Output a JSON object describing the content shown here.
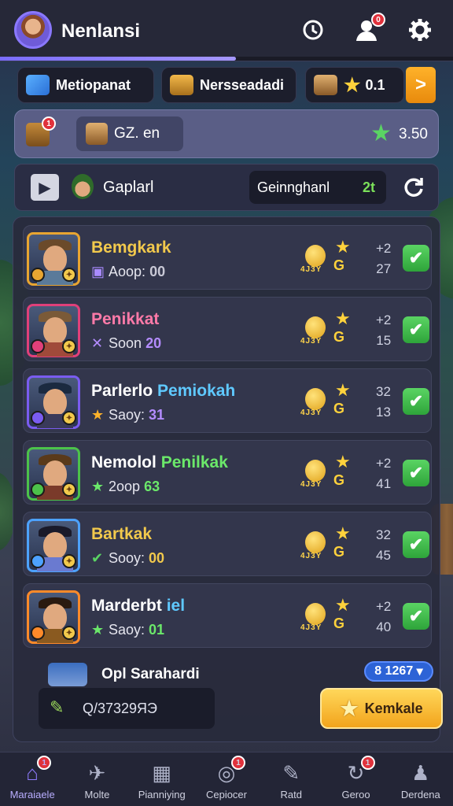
{
  "header": {
    "title": "Nenlansi",
    "notification_badge": "0",
    "icons": [
      "history-icon",
      "profile-icon",
      "settings-icon"
    ],
    "progress_fraction": 0.52
  },
  "resources": {
    "item1_label": "Metiopanat",
    "item2_label": "Nersseadadi",
    "star_value": "0.1",
    "plus_label": ">"
  },
  "info_panel": {
    "chest_badge": "1",
    "pill_value": "GZ. en",
    "star_value": "3.50"
  },
  "gameplay": {
    "label": "Gaplarl",
    "box_label": "Geinnghanl",
    "box_count": "2t"
  },
  "rows": [
    {
      "name": "Bemgkark",
      "sub_label": "Aoop:",
      "sub_value": "00",
      "coin_text": "4J3Y",
      "g": "G",
      "n1": "+2",
      "n2": "27",
      "frame": "#e8a531",
      "name_color": "#f2c94c",
      "sub_color": "#c9c9d6",
      "sub_icon": "▣",
      "sub_icon_color": "#a98bff"
    },
    {
      "name": "Penikkat",
      "sub_label": "Soon",
      "sub_value": "20",
      "coin_text": "4J3Y",
      "g": "G",
      "n1": "+2",
      "n2": "15",
      "frame": "#e0407a",
      "name_color": "#ff7aa8",
      "sub_color": "#b48cff",
      "sub_icon": "✕",
      "sub_icon_color": "#b48cff"
    },
    {
      "name": "Parlerlo ",
      "name2": "Pemiokah",
      "sub_label": "Saoy:",
      "sub_value": "31",
      "coin_text": "4J3Y",
      "g": "G",
      "n1": "32",
      "n2": "13",
      "frame": "#7a5cf0",
      "name_color": "#ffffff",
      "name2_color": "#5fc9ff",
      "sub_color": "#b48cff",
      "sub_icon": "★",
      "sub_icon_color": "#ffb22a"
    },
    {
      "name": "Nemolol ",
      "name2": "Penilkak",
      "sub_label": "2oop",
      "sub_value": "63",
      "coin_text": "4J3Y",
      "g": "G",
      "n1": "+2",
      "n2": "41",
      "frame": "#4cc24a",
      "name_color": "#ffffff",
      "name2_color": "#6be86a",
      "sub_color": "#6be86a",
      "sub_icon": "★",
      "sub_icon_color": "#6be86a"
    },
    {
      "name": "Bartkak",
      "sub_label": "Sooy:",
      "sub_value": "00",
      "coin_text": "4J3Y",
      "g": "G",
      "n1": "32",
      "n2": "45",
      "frame": "#4da2ff",
      "name_color": "#f2c94c",
      "sub_color": "#f2c94c",
      "sub_icon": "✔",
      "sub_icon_color": "#5ad463"
    },
    {
      "name": "Marderbt ",
      "name2": "iel",
      "sub_label": "Saoy:",
      "sub_value": "01",
      "coin_text": "4J3Y",
      "g": "G",
      "n1": "+2",
      "n2": "40",
      "frame": "#ff8a2a",
      "name_color": "#ffffff",
      "name2_color": "#5fc9ff",
      "sub_color": "#6be86a",
      "sub_icon": "★",
      "sub_icon_color": "#6be86a"
    }
  ],
  "footer": {
    "label": "Opl Sarahardi",
    "badge": "8 1267",
    "search_value": "Q/37329ЯЭ",
    "action_label": "Kemkale"
  },
  "nav": [
    {
      "label": "Maraiaele",
      "icon": "home-icon",
      "glyph": "⌂",
      "badge": "1",
      "active": true
    },
    {
      "label": "Molte",
      "icon": "plane-icon",
      "glyph": "✈",
      "badge": "",
      "active": false
    },
    {
      "label": "Pianniying",
      "icon": "calendar-icon",
      "glyph": "▦",
      "badge": "",
      "active": false
    },
    {
      "label": "Cepiocer",
      "icon": "target-icon",
      "glyph": "◎",
      "badge": "1",
      "active": false
    },
    {
      "label": "Ratd",
      "icon": "rocket-icon",
      "glyph": "✎",
      "badge": "",
      "active": false
    },
    {
      "label": "Geroo",
      "icon": "swirl-icon",
      "glyph": "↻",
      "badge": "1",
      "active": false
    },
    {
      "label": "Derdena",
      "icon": "person-icon",
      "glyph": "♟",
      "badge": "",
      "active": false
    }
  ],
  "colors": {
    "accent": "#8f7cff",
    "gold": "#f2c94c",
    "check": "#3ab847",
    "badge": "#e0323c"
  }
}
